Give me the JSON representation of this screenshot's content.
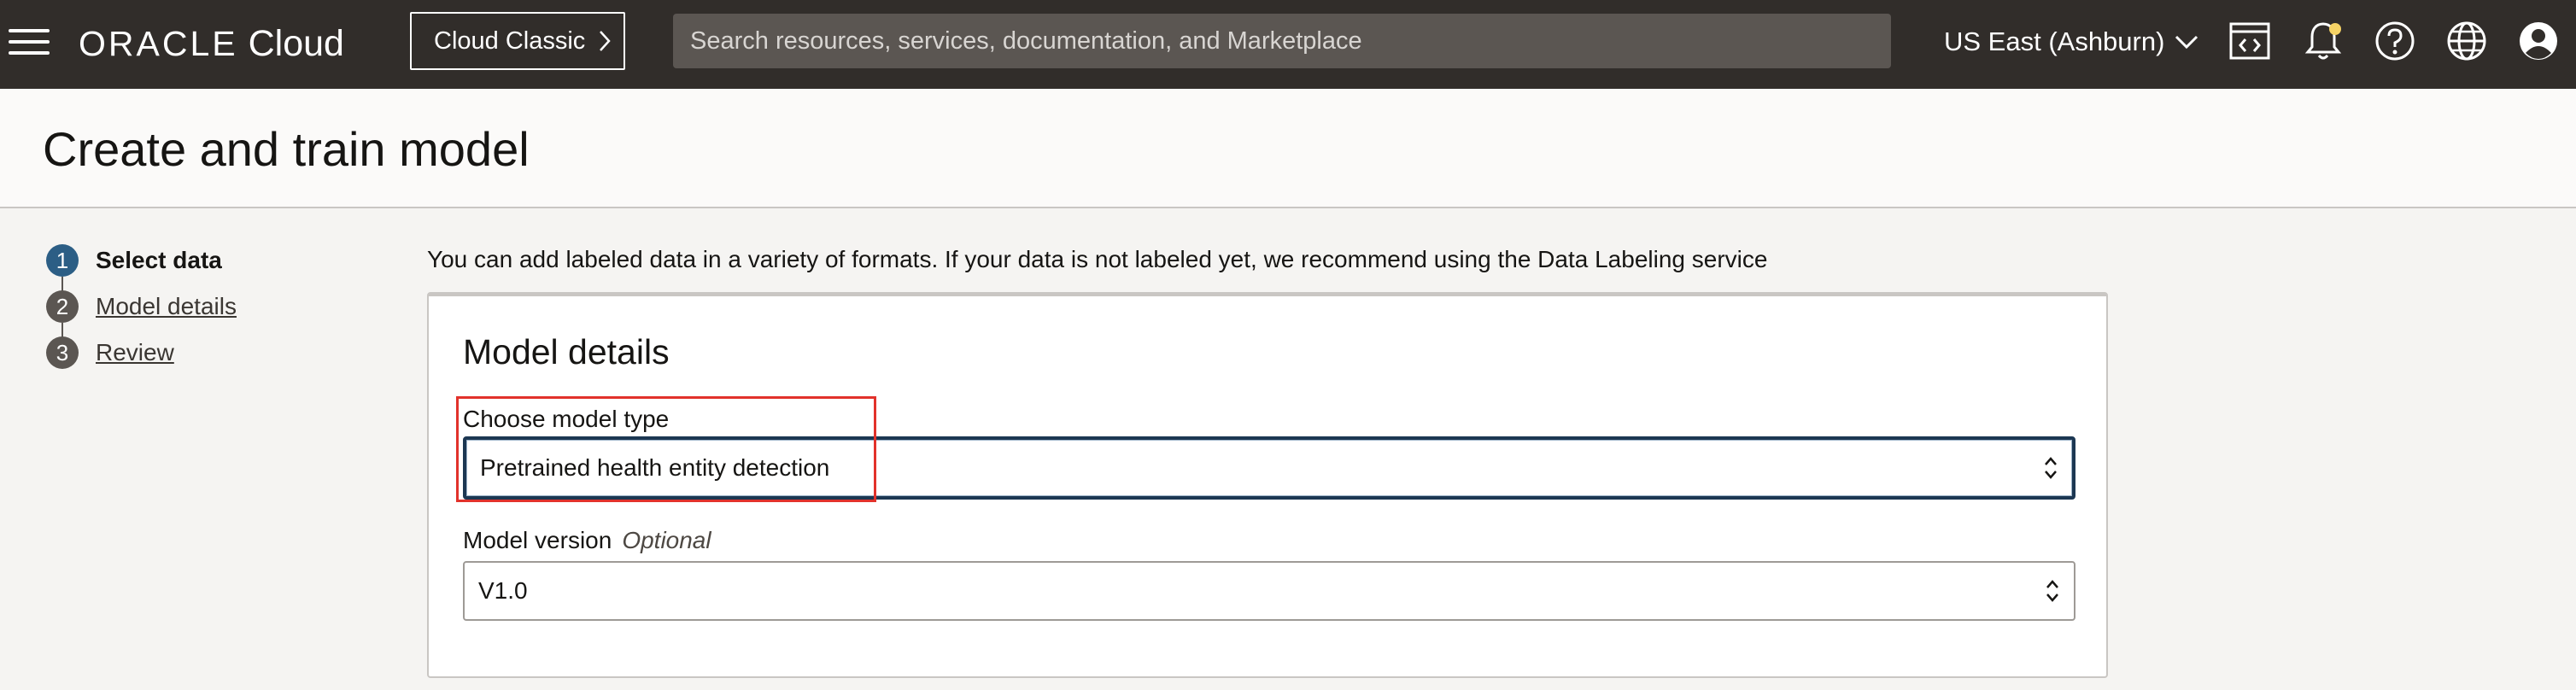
{
  "topbar": {
    "logo_oracle": "ORACLE",
    "logo_cloud": "Cloud",
    "cloud_classic_label": "Cloud Classic",
    "search_placeholder": "Search resources, services, documentation, and Marketplace",
    "region_label": "US East (Ashburn)",
    "icons": [
      "menu-icon",
      "code-editor-icon",
      "bell-icon",
      "help-icon",
      "globe-icon",
      "profile-icon"
    ],
    "notification_dot_color": "#f6d365"
  },
  "header": {
    "title": "Create and train model"
  },
  "steps": [
    {
      "number": "1",
      "label": "Select data",
      "state": "current"
    },
    {
      "number": "2",
      "label": "Model details",
      "state": "link"
    },
    {
      "number": "3",
      "label": "Review",
      "state": "link"
    }
  ],
  "main": {
    "intro_text": "You can add labeled data in a variety of formats. If your data is not labeled yet, we recommend using the Data Labeling service",
    "card": {
      "title": "Model details",
      "model_type": {
        "label": "Choose model type",
        "value": "Pretrained health entity detection"
      },
      "model_version": {
        "label": "Model version",
        "optional_label": "Optional",
        "value": "V1.0"
      }
    }
  },
  "colors": {
    "topbar_bg": "#312d2a",
    "current_step": "#2c5e85",
    "highlight": "#e2322b"
  }
}
